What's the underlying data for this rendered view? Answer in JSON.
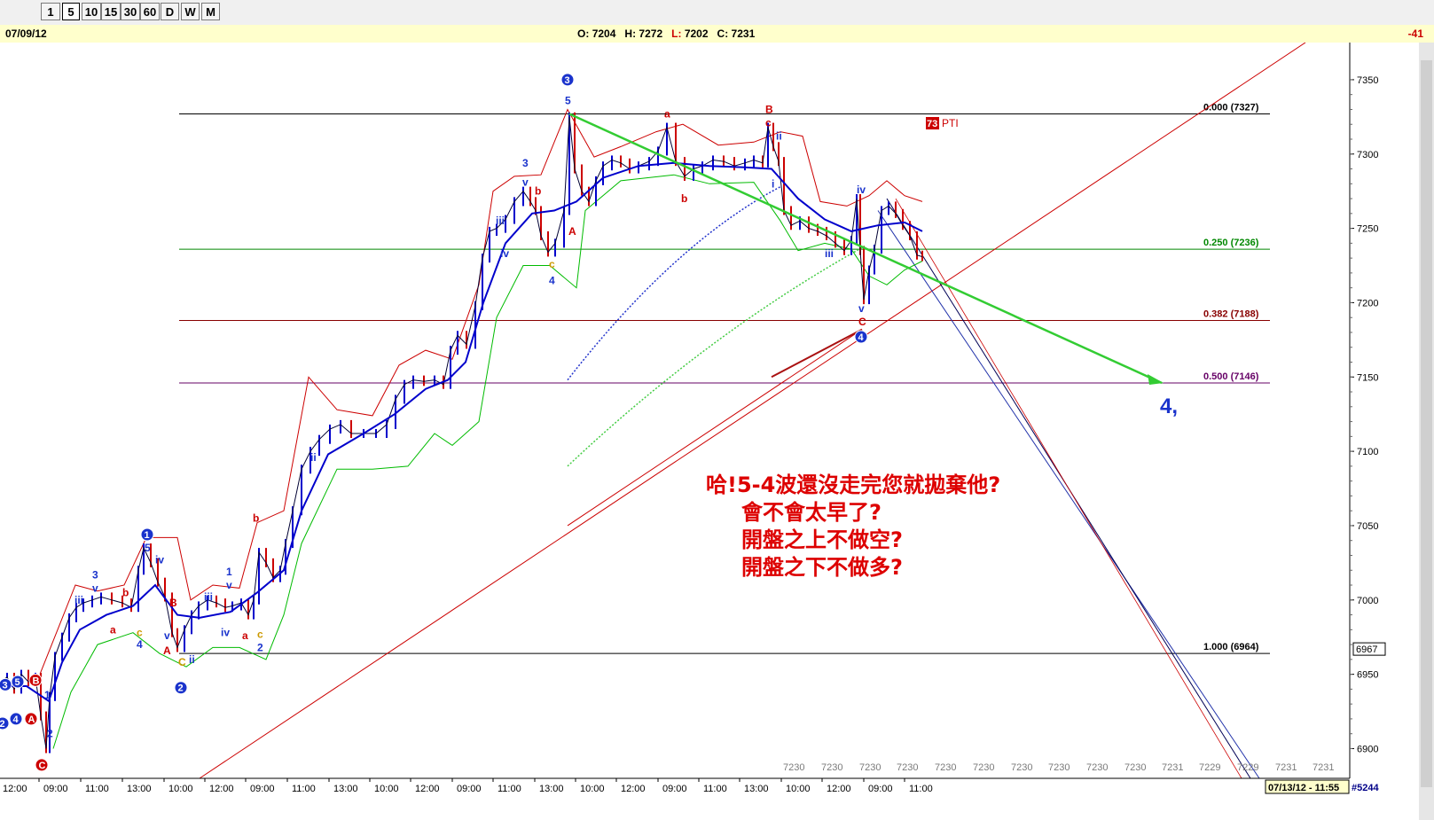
{
  "toolbar": {
    "timeframes": [
      "1",
      "5",
      "10",
      "15",
      "30",
      "60",
      "D",
      "W",
      "M"
    ],
    "active": "5"
  },
  "header": {
    "date": "07/09/12",
    "ohlc": {
      "o_label": "O:",
      "o": "7204",
      "h_label": "H:",
      "h": "7272",
      "l_label": "L:",
      "l": "7202",
      "c_label": "C:",
      "c": "7231"
    },
    "change": "-41"
  },
  "colors": {
    "price_up": "#0000cc",
    "price_down": "#cc0000",
    "ma_blue": "#0000cc",
    "band_upper": "#cc0000",
    "band_lower": "#00bb00",
    "trend_green": "#33cc33",
    "fib_0": "#000000",
    "fib_250": "#008800",
    "fib_382": "#880000",
    "fib_500": "#660066",
    "annotation": "#dd0000",
    "wave_blue": "#1a33cc"
  },
  "chart_data": {
    "type": "line",
    "ylim": [
      6880,
      7375
    ],
    "y_ticks": [
      "7350",
      "7300",
      "7250",
      "7200",
      "7150",
      "7100",
      "7050",
      "7000",
      "6950",
      "6900"
    ],
    "last_price_label": "6967",
    "x_tick_labels": [
      "12:00",
      "09:00",
      "11:00",
      "13:00",
      "10:00",
      "12:00",
      "09:00",
      "11:00",
      "13:00",
      "10:00",
      "12:00",
      "09:00",
      "11:00",
      "13:00",
      "10:00",
      "12:00",
      "09:00",
      "11:00",
      "13:00",
      "10:00",
      "12:00",
      "09:00",
      "11:00"
    ],
    "future_row": [
      "7230",
      "7230",
      "7230",
      "7230",
      "7230",
      "7230",
      "7230",
      "7230",
      "7230",
      "7230",
      "7231",
      "7229",
      "7229",
      "7231",
      "7231"
    ],
    "date_stamp": "07/13/12 - 11:55",
    "bar_count": "#5244",
    "fib_levels": [
      {
        "label": "0.000 (7327)",
        "value": 7327
      },
      {
        "label": "0.250 (7236)",
        "value": 7236
      },
      {
        "label": "0.382 (7188)",
        "value": 7188
      },
      {
        "label": "0.500 (7146)",
        "value": 7146
      },
      {
        "label": "1.000 (6964)",
        "value": 6964
      }
    ],
    "price_series": [
      [
        0,
        6945
      ],
      [
        8,
        6948
      ],
      [
        16,
        6940
      ],
      [
        24,
        6950
      ],
      [
        32,
        6945
      ],
      [
        40,
        6948
      ],
      [
        46,
        6922
      ],
      [
        52,
        6900
      ],
      [
        56,
        6935
      ],
      [
        62,
        6962
      ],
      [
        70,
        6975
      ],
      [
        78,
        6988
      ],
      [
        86,
        6995
      ],
      [
        94,
        6998
      ],
      [
        104,
        7000
      ],
      [
        114,
        7002
      ],
      [
        126,
        7000
      ],
      [
        138,
        6998
      ],
      [
        148,
        6995
      ],
      [
        156,
        7020
      ],
      [
        162,
        7035
      ],
      [
        170,
        7025
      ],
      [
        178,
        7012
      ],
      [
        186,
        7002
      ],
      [
        194,
        6978
      ],
      [
        200,
        6968
      ],
      [
        208,
        6980
      ],
      [
        216,
        6990
      ],
      [
        224,
        6996
      ],
      [
        234,
        7000
      ],
      [
        244,
        6998
      ],
      [
        254,
        6995
      ],
      [
        262,
        6996
      ],
      [
        272,
        6998
      ],
      [
        280,
        6990
      ],
      [
        286,
        7000
      ],
      [
        292,
        7032
      ],
      [
        300,
        7025
      ],
      [
        308,
        7015
      ],
      [
        316,
        7020
      ],
      [
        322,
        7038
      ],
      [
        330,
        7060
      ],
      [
        340,
        7088
      ],
      [
        350,
        7100
      ],
      [
        360,
        7108
      ],
      [
        372,
        7115
      ],
      [
        384,
        7118
      ],
      [
        396,
        7112
      ],
      [
        410,
        7112
      ],
      [
        424,
        7112
      ],
      [
        436,
        7118
      ],
      [
        446,
        7135
      ],
      [
        456,
        7145
      ],
      [
        466,
        7148
      ],
      [
        478,
        7147
      ],
      [
        490,
        7148
      ],
      [
        500,
        7145
      ],
      [
        508,
        7168
      ],
      [
        516,
        7178
      ],
      [
        526,
        7172
      ],
      [
        536,
        7198
      ],
      [
        544,
        7230
      ],
      [
        552,
        7248
      ],
      [
        560,
        7250
      ],
      [
        570,
        7256
      ],
      [
        580,
        7268
      ],
      [
        590,
        7275
      ],
      [
        598,
        7268
      ],
      [
        604,
        7262
      ],
      [
        610,
        7245
      ],
      [
        618,
        7234
      ],
      [
        626,
        7240
      ],
      [
        636,
        7262
      ],
      [
        642,
        7325
      ],
      [
        648,
        7290
      ],
      [
        656,
        7275
      ],
      [
        664,
        7268
      ],
      [
        672,
        7282
      ],
      [
        680,
        7292
      ],
      [
        690,
        7296
      ],
      [
        700,
        7294
      ],
      [
        710,
        7290
      ],
      [
        720,
        7292
      ],
      [
        732,
        7295
      ],
      [
        742,
        7302
      ],
      [
        752,
        7318
      ],
      [
        762,
        7295
      ],
      [
        772,
        7285
      ],
      [
        782,
        7290
      ],
      [
        792,
        7292
      ],
      [
        804,
        7296
      ],
      [
        816,
        7295
      ],
      [
        828,
        7292
      ],
      [
        840,
        7294
      ],
      [
        850,
        7296
      ],
      [
        860,
        7294
      ],
      [
        866,
        7318
      ],
      [
        872,
        7305
      ],
      [
        878,
        7295
      ],
      [
        884,
        7262
      ],
      [
        892,
        7252
      ],
      [
        902,
        7255
      ],
      [
        912,
        7250
      ],
      [
        922,
        7248
      ],
      [
        932,
        7245
      ],
      [
        942,
        7240
      ],
      [
        952,
        7235
      ],
      [
        960,
        7242
      ],
      [
        966,
        7270
      ],
      [
        970,
        7235
      ],
      [
        974,
        7202
      ],
      [
        980,
        7222
      ],
      [
        986,
        7236
      ],
      [
        994,
        7262
      ],
      [
        1002,
        7265
      ],
      [
        1010,
        7260
      ],
      [
        1018,
        7252
      ],
      [
        1026,
        7245
      ],
      [
        1034,
        7232
      ],
      [
        1040,
        7231
      ]
    ],
    "ma_series": [
      [
        0,
        6942
      ],
      [
        30,
        6942
      ],
      [
        55,
        6932
      ],
      [
        70,
        6958
      ],
      [
        90,
        6980
      ],
      [
        120,
        6990
      ],
      [
        150,
        6996
      ],
      [
        175,
        7010
      ],
      [
        200,
        6990
      ],
      [
        225,
        6988
      ],
      [
        260,
        6992
      ],
      [
        290,
        7005
      ],
      [
        320,
        7020
      ],
      [
        340,
        7060
      ],
      [
        370,
        7098
      ],
      [
        410,
        7112
      ],
      [
        445,
        7125
      ],
      [
        480,
        7142
      ],
      [
        505,
        7148
      ],
      [
        525,
        7160
      ],
      [
        545,
        7200
      ],
      [
        570,
        7240
      ],
      [
        600,
        7260
      ],
      [
        625,
        7262
      ],
      [
        650,
        7268
      ],
      [
        680,
        7284
      ],
      [
        720,
        7292
      ],
      [
        760,
        7294
      ],
      [
        800,
        7292
      ],
      [
        840,
        7291
      ],
      [
        870,
        7290
      ],
      [
        900,
        7270
      ],
      [
        930,
        7256
      ],
      [
        960,
        7248
      ],
      [
        990,
        7252
      ],
      [
        1020,
        7254
      ],
      [
        1040,
        7248
      ]
    ],
    "upper_band": [
      [
        45,
        6950
      ],
      [
        65,
        6980
      ],
      [
        85,
        7010
      ],
      [
        110,
        7006
      ],
      [
        140,
        7010
      ],
      [
        165,
        7042
      ],
      [
        200,
        7042
      ],
      [
        215,
        7000
      ],
      [
        240,
        7010
      ],
      [
        270,
        7008
      ],
      [
        290,
        7052
      ],
      [
        320,
        7060
      ],
      [
        348,
        7150
      ],
      [
        380,
        7128
      ],
      [
        420,
        7124
      ],
      [
        450,
        7158
      ],
      [
        480,
        7168
      ],
      [
        510,
        7162
      ],
      [
        540,
        7212
      ],
      [
        556,
        7275
      ],
      [
        580,
        7285
      ],
      [
        610,
        7286
      ],
      [
        640,
        7330
      ],
      [
        670,
        7298
      ],
      [
        700,
        7305
      ],
      [
        740,
        7315
      ],
      [
        770,
        7320
      ],
      [
        810,
        7306
      ],
      [
        850,
        7308
      ],
      [
        880,
        7315
      ],
      [
        905,
        7312
      ],
      [
        925,
        7268
      ],
      [
        955,
        7265
      ],
      [
        980,
        7272
      ],
      [
        1000,
        7282
      ],
      [
        1020,
        7272
      ],
      [
        1040,
        7268
      ]
    ],
    "lower_band": [
      [
        60,
        6900
      ],
      [
        80,
        6938
      ],
      [
        110,
        6970
      ],
      [
        150,
        6978
      ],
      [
        180,
        6964
      ],
      [
        210,
        6955
      ],
      [
        240,
        6968
      ],
      [
        270,
        6968
      ],
      [
        300,
        6960
      ],
      [
        320,
        6990
      ],
      [
        340,
        7038
      ],
      [
        380,
        7088
      ],
      [
        420,
        7088
      ],
      [
        460,
        7090
      ],
      [
        490,
        7112
      ],
      [
        510,
        7104
      ],
      [
        540,
        7120
      ],
      [
        560,
        7190
      ],
      [
        590,
        7225
      ],
      [
        620,
        7225
      ],
      [
        650,
        7210
      ],
      [
        660,
        7262
      ],
      [
        700,
        7282
      ],
      [
        760,
        7286
      ],
      [
        800,
        7280
      ],
      [
        850,
        7281
      ],
      [
        880,
        7255
      ],
      [
        900,
        7235
      ],
      [
        930,
        7240
      ],
      [
        960,
        7236
      ],
      [
        980,
        7218
      ],
      [
        1000,
        7212
      ],
      [
        1020,
        7222
      ],
      [
        1040,
        7228
      ]
    ],
    "wave_labels": [
      {
        "text": "3",
        "x": 640,
        "y": 7350,
        "circle": true,
        "color": "#1a33cc"
      },
      {
        "text": "5",
        "x": 640,
        "y": 7336,
        "circle": false,
        "color": "#1a33cc"
      },
      {
        "text": "a",
        "x": 752,
        "y": 7327,
        "circle": false,
        "color": "#cc0000"
      },
      {
        "text": "B",
        "x": 866,
        "y": 7330,
        "circle": false,
        "color": "#cc0000"
      },
      {
        "text": "c",
        "x": 866,
        "y": 7321,
        "circle": false,
        "color": "#cc0000"
      },
      {
        "text": "ii",
        "x": 878,
        "y": 7312,
        "circle": false,
        "color": "#1a33cc"
      },
      {
        "text": "i",
        "x": 873,
        "y": 7280,
        "circle": false,
        "color": "#1a33cc"
      },
      {
        "text": "b",
        "x": 771,
        "y": 7270,
        "circle": false,
        "color": "#cc0000"
      },
      {
        "text": "A",
        "x": 644,
        "y": 7248,
        "circle": false,
        "color": "#cc0000"
      },
      {
        "text": "3",
        "x": 592,
        "y": 7294,
        "circle": false,
        "color": "#1a33cc"
      },
      {
        "text": "v",
        "x": 592,
        "y": 7281,
        "circle": false,
        "color": "#1a33cc"
      },
      {
        "text": "b",
        "x": 606,
        "y": 7275,
        "circle": false,
        "color": "#cc0000"
      },
      {
        "text": "iii",
        "x": 562,
        "y": 7255,
        "circle": false,
        "color": "#1a33cc"
      },
      {
        "text": "iv",
        "x": 567,
        "y": 7233,
        "circle": false,
        "color": "#1a33cc"
      },
      {
        "text": "c",
        "x": 622,
        "y": 7226,
        "circle": false,
        "color": "#cc9900"
      },
      {
        "text": "4",
        "x": 622,
        "y": 7215,
        "circle": false,
        "color": "#1a33cc"
      },
      {
        "text": "iv",
        "x": 969,
        "y": 7276,
        "circle": false,
        "color": "#1a33cc"
      },
      {
        "text": "iii",
        "x": 933,
        "y": 7233,
        "circle": false,
        "color": "#1a33cc"
      },
      {
        "text": "v",
        "x": 971,
        "y": 7196,
        "circle": false,
        "color": "#1a33cc"
      },
      {
        "text": "C",
        "x": 971,
        "y": 7187,
        "circle": false,
        "color": "#cc0000"
      },
      {
        "text": "4",
        "x": 971,
        "y": 7177,
        "circle": true,
        "color": "#1a33cc"
      },
      {
        "text": "1",
        "x": 166,
        "y": 7044,
        "circle": true,
        "color": "#1a33cc"
      },
      {
        "text": "5",
        "x": 166,
        "y": 7035,
        "circle": false,
        "color": "#1a33cc"
      },
      {
        "text": "iv",
        "x": 178,
        "y": 7027,
        "circle": false,
        "color": "#1a33cc"
      },
      {
        "text": "3",
        "x": 107,
        "y": 7017,
        "circle": false,
        "color": "#1a33cc"
      },
      {
        "text": "v",
        "x": 107,
        "y": 7008,
        "circle": false,
        "color": "#1a33cc"
      },
      {
        "text": "b",
        "x": 141,
        "y": 7005,
        "circle": false,
        "color": "#cc0000"
      },
      {
        "text": "iii",
        "x": 87,
        "y": 7000,
        "circle": false,
        "color": "#1a33cc"
      },
      {
        "text": "a",
        "x": 127,
        "y": 6980,
        "circle": false,
        "color": "#cc0000"
      },
      {
        "text": "c",
        "x": 157,
        "y": 6978,
        "circle": false,
        "color": "#cc9900"
      },
      {
        "text": "4",
        "x": 157,
        "y": 6970,
        "circle": false,
        "color": "#1a33cc"
      },
      {
        "text": "B",
        "x": 194,
        "y": 6998,
        "circle": false,
        "color": "#cc0000"
      },
      {
        "text": "v",
        "x": 188,
        "y": 6976,
        "circle": false,
        "color": "#1a33cc"
      },
      {
        "text": "A",
        "x": 187,
        "y": 6966,
        "circle": false,
        "color": "#cc0000"
      },
      {
        "text": "C",
        "x": 204,
        "y": 6958,
        "circle": false,
        "color": "#cc9900"
      },
      {
        "text": "ii",
        "x": 216,
        "y": 6960,
        "circle": false,
        "color": "#1a33cc"
      },
      {
        "text": "2",
        "x": 204,
        "y": 6941,
        "circle": true,
        "color": "#1a33cc"
      },
      {
        "text": "iii",
        "x": 233,
        "y": 7002,
        "circle": false,
        "color": "#1a33cc"
      },
      {
        "text": "iv",
        "x": 252,
        "y": 6978,
        "circle": false,
        "color": "#1a33cc"
      },
      {
        "text": "a",
        "x": 276,
        "y": 6976,
        "circle": false,
        "color": "#cc0000"
      },
      {
        "text": "1",
        "x": 258,
        "y": 7019,
        "circle": false,
        "color": "#1a33cc"
      },
      {
        "text": "v",
        "x": 258,
        "y": 7010,
        "circle": false,
        "color": "#1a33cc"
      },
      {
        "text": "b",
        "x": 288,
        "y": 7055,
        "circle": false,
        "color": "#cc0000"
      },
      {
        "text": "c",
        "x": 293,
        "y": 6977,
        "circle": false,
        "color": "#cc9900"
      },
      {
        "text": "2",
        "x": 293,
        "y": 6968,
        "circle": false,
        "color": "#1a33cc"
      },
      {
        "text": "ii",
        "x": 353,
        "y": 7096,
        "circle": false,
        "color": "#1a33cc"
      },
      {
        "text": "1",
        "x": 53,
        "y": 6936,
        "circle": false,
        "color": "#1a33cc"
      },
      {
        "text": "2",
        "x": 56,
        "y": 6910,
        "circle": false,
        "color": "#1a33cc"
      },
      {
        "text": "C",
        "x": 47,
        "y": 6889,
        "circle": true,
        "color": "#cc0000"
      },
      {
        "text": "A",
        "x": 35,
        "y": 6920,
        "circle": true,
        "color": "#cc0000"
      },
      {
        "text": "B",
        "x": 40,
        "y": 6946,
        "circle": true,
        "color": "#cc0000"
      },
      {
        "text": "5",
        "x": 20,
        "y": 6945,
        "circle": true,
        "color": "#1a33cc"
      },
      {
        "text": "4",
        "x": 18,
        "y": 6920,
        "circle": true,
        "color": "#1a33cc"
      },
      {
        "text": "3",
        "x": 6,
        "y": 6943,
        "circle": true,
        "color": "#1a33cc"
      },
      {
        "text": "2",
        "x": 3,
        "y": 6917,
        "circle": true,
        "color": "#1a33cc"
      }
    ],
    "pti_badge": {
      "num": "73",
      "text": "PTI"
    },
    "target_label": "4,",
    "annotation": [
      "哈!5-4波還沒走完您就拋棄他?",
      "會不會太早了?",
      "開盤之上不做空?",
      "開盤之下不做多?"
    ]
  }
}
